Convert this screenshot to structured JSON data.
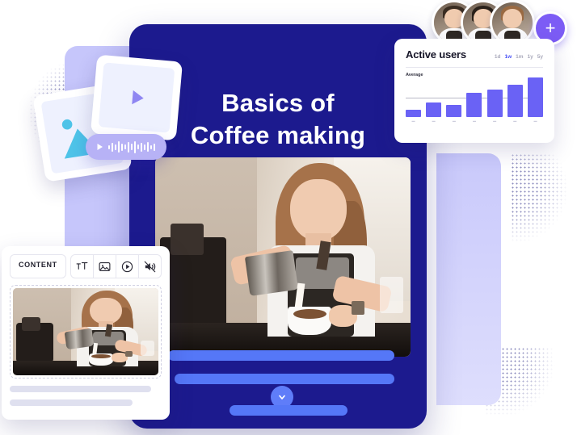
{
  "course_card": {
    "title_line_1": "Basics of",
    "title_line_2": "Coffee making",
    "hero_image_alt": "barista-pouring-milk",
    "expand_icon": "chevron-down-icon"
  },
  "avatars": {
    "people": [
      {
        "name": "avatar-person-1",
        "hair": "#3a2d22"
      },
      {
        "name": "avatar-person-2",
        "hair": "#2a211a"
      },
      {
        "name": "avatar-person-3",
        "hair": "#9a6a42"
      }
    ],
    "add_label": "+"
  },
  "analytics": {
    "title": "Active users",
    "average_label": "Average",
    "ranges": [
      {
        "label": "1d",
        "active": false
      },
      {
        "label": "1w",
        "active": true
      },
      {
        "label": "1m",
        "active": false
      },
      {
        "label": "1y",
        "active": false
      },
      {
        "label": "5y",
        "active": false
      }
    ],
    "accent_color": "#4b53f6",
    "bar_color": "#6a62f5"
  },
  "chart_data": {
    "type": "bar",
    "title": "Active users",
    "xlabel": "",
    "ylabel": "",
    "categories": [
      "",
      "",
      "",
      "",
      "",
      "",
      ""
    ],
    "values": [
      10,
      20,
      17,
      33,
      38,
      44,
      54
    ],
    "ylim": [
      0,
      60
    ],
    "grid": false,
    "legend": "none",
    "annotations": [
      {
        "type": "hline",
        "label": "Average",
        "value": 33
      }
    ],
    "series": [
      {
        "name": "Active users",
        "values": [
          10,
          20,
          17,
          33,
          38,
          44,
          54
        ]
      }
    ]
  },
  "media_cards": {
    "image_card": {
      "icon": "image-icon"
    },
    "video_card": {
      "icon": "play-triangle-icon"
    },
    "audio_pill": {
      "icon": "play-triangle-icon",
      "waveform": [
        5,
        11,
        7,
        14,
        9,
        6,
        13,
        8,
        15,
        6,
        11,
        7,
        12,
        5,
        9
      ]
    }
  },
  "content_panel": {
    "tab_label": "CONTENT",
    "tools": [
      {
        "name": "text-size-icon",
        "glyph": "тT"
      },
      {
        "name": "image-icon",
        "glyph": ""
      },
      {
        "name": "play-circle-icon",
        "glyph": ""
      },
      {
        "name": "mute-audio-icon",
        "glyph": ""
      }
    ],
    "thumbnail_alt": "barista-pouring-milk-thumbnail"
  },
  "theme": {
    "card_navy": "#1c1a8e",
    "lavender": "#c6c6fb",
    "line_blue": "#5577f7",
    "purple": "#7c5cf5"
  }
}
